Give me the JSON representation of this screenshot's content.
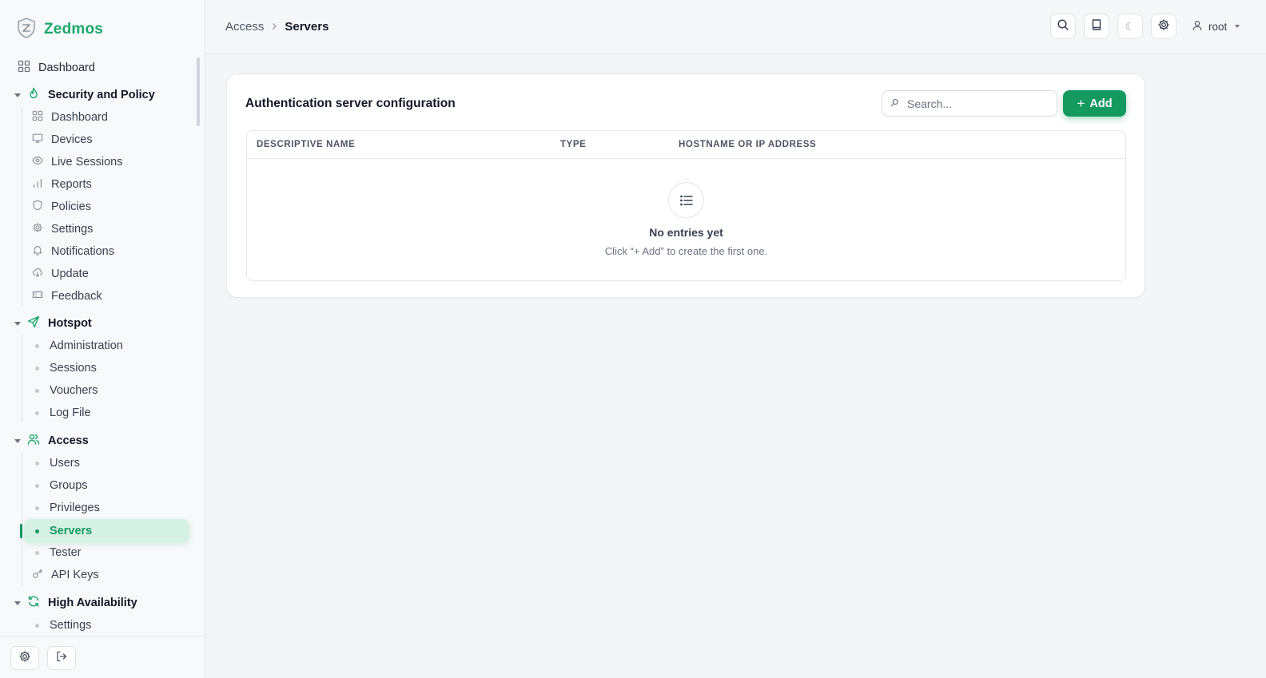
{
  "brand": {
    "name": "Zedmos",
    "accent": "#1aa86b"
  },
  "sidebar": {
    "top_item": {
      "label": "Dashboard",
      "icon": "grid-icon"
    },
    "groups": [
      {
        "title": "Security and Policy",
        "icon": "flame-icon",
        "items": [
          {
            "label": "Dashboard",
            "icon": "grid-icon"
          },
          {
            "label": "Devices",
            "icon": "monitor-icon"
          },
          {
            "label": "Live Sessions",
            "icon": "eye-icon"
          },
          {
            "label": "Reports",
            "icon": "bar-chart-icon"
          },
          {
            "label": "Policies",
            "icon": "shield-icon"
          },
          {
            "label": "Settings",
            "icon": "gear-icon"
          },
          {
            "label": "Notifications",
            "icon": "bell-icon"
          },
          {
            "label": "Update",
            "icon": "cloud-download-icon"
          },
          {
            "label": "Feedback",
            "icon": "ticket-icon"
          }
        ]
      },
      {
        "title": "Hotspot",
        "icon": "send-icon",
        "items": [
          {
            "label": "Administration"
          },
          {
            "label": "Sessions"
          },
          {
            "label": "Vouchers"
          },
          {
            "label": "Log File"
          }
        ]
      },
      {
        "title": "Access",
        "icon": "users-icon",
        "items": [
          {
            "label": "Users"
          },
          {
            "label": "Groups"
          },
          {
            "label": "Privileges"
          },
          {
            "label": "Servers",
            "active": true
          },
          {
            "label": "Tester"
          },
          {
            "label": "API Keys",
            "icon": "key-icon"
          }
        ]
      },
      {
        "title": "High Availability",
        "icon": "refresh-icon",
        "items": [
          {
            "label": "Settings"
          }
        ]
      }
    ],
    "bottom_buttons": [
      {
        "icon": "gear-icon"
      },
      {
        "icon": "logout-icon"
      }
    ]
  },
  "topbar": {
    "breadcrumb": {
      "parent": "Access",
      "current": "Servers"
    },
    "buttons": [
      "search-icon",
      "book-icon",
      "moon-icon",
      "gear-icon"
    ],
    "moon_glyph": "☾",
    "user": "root"
  },
  "card": {
    "title": "Authentication server configuration",
    "search_placeholder": "Search...",
    "add_label": "Add",
    "add_plus": "+",
    "columns": [
      "DESCRIPTIVE NAME",
      "TYPE",
      "HOSTNAME OR IP ADDRESS"
    ],
    "empty": {
      "title": "No entries yet",
      "subtitle": "Click “+ Add” to create the first one."
    }
  }
}
